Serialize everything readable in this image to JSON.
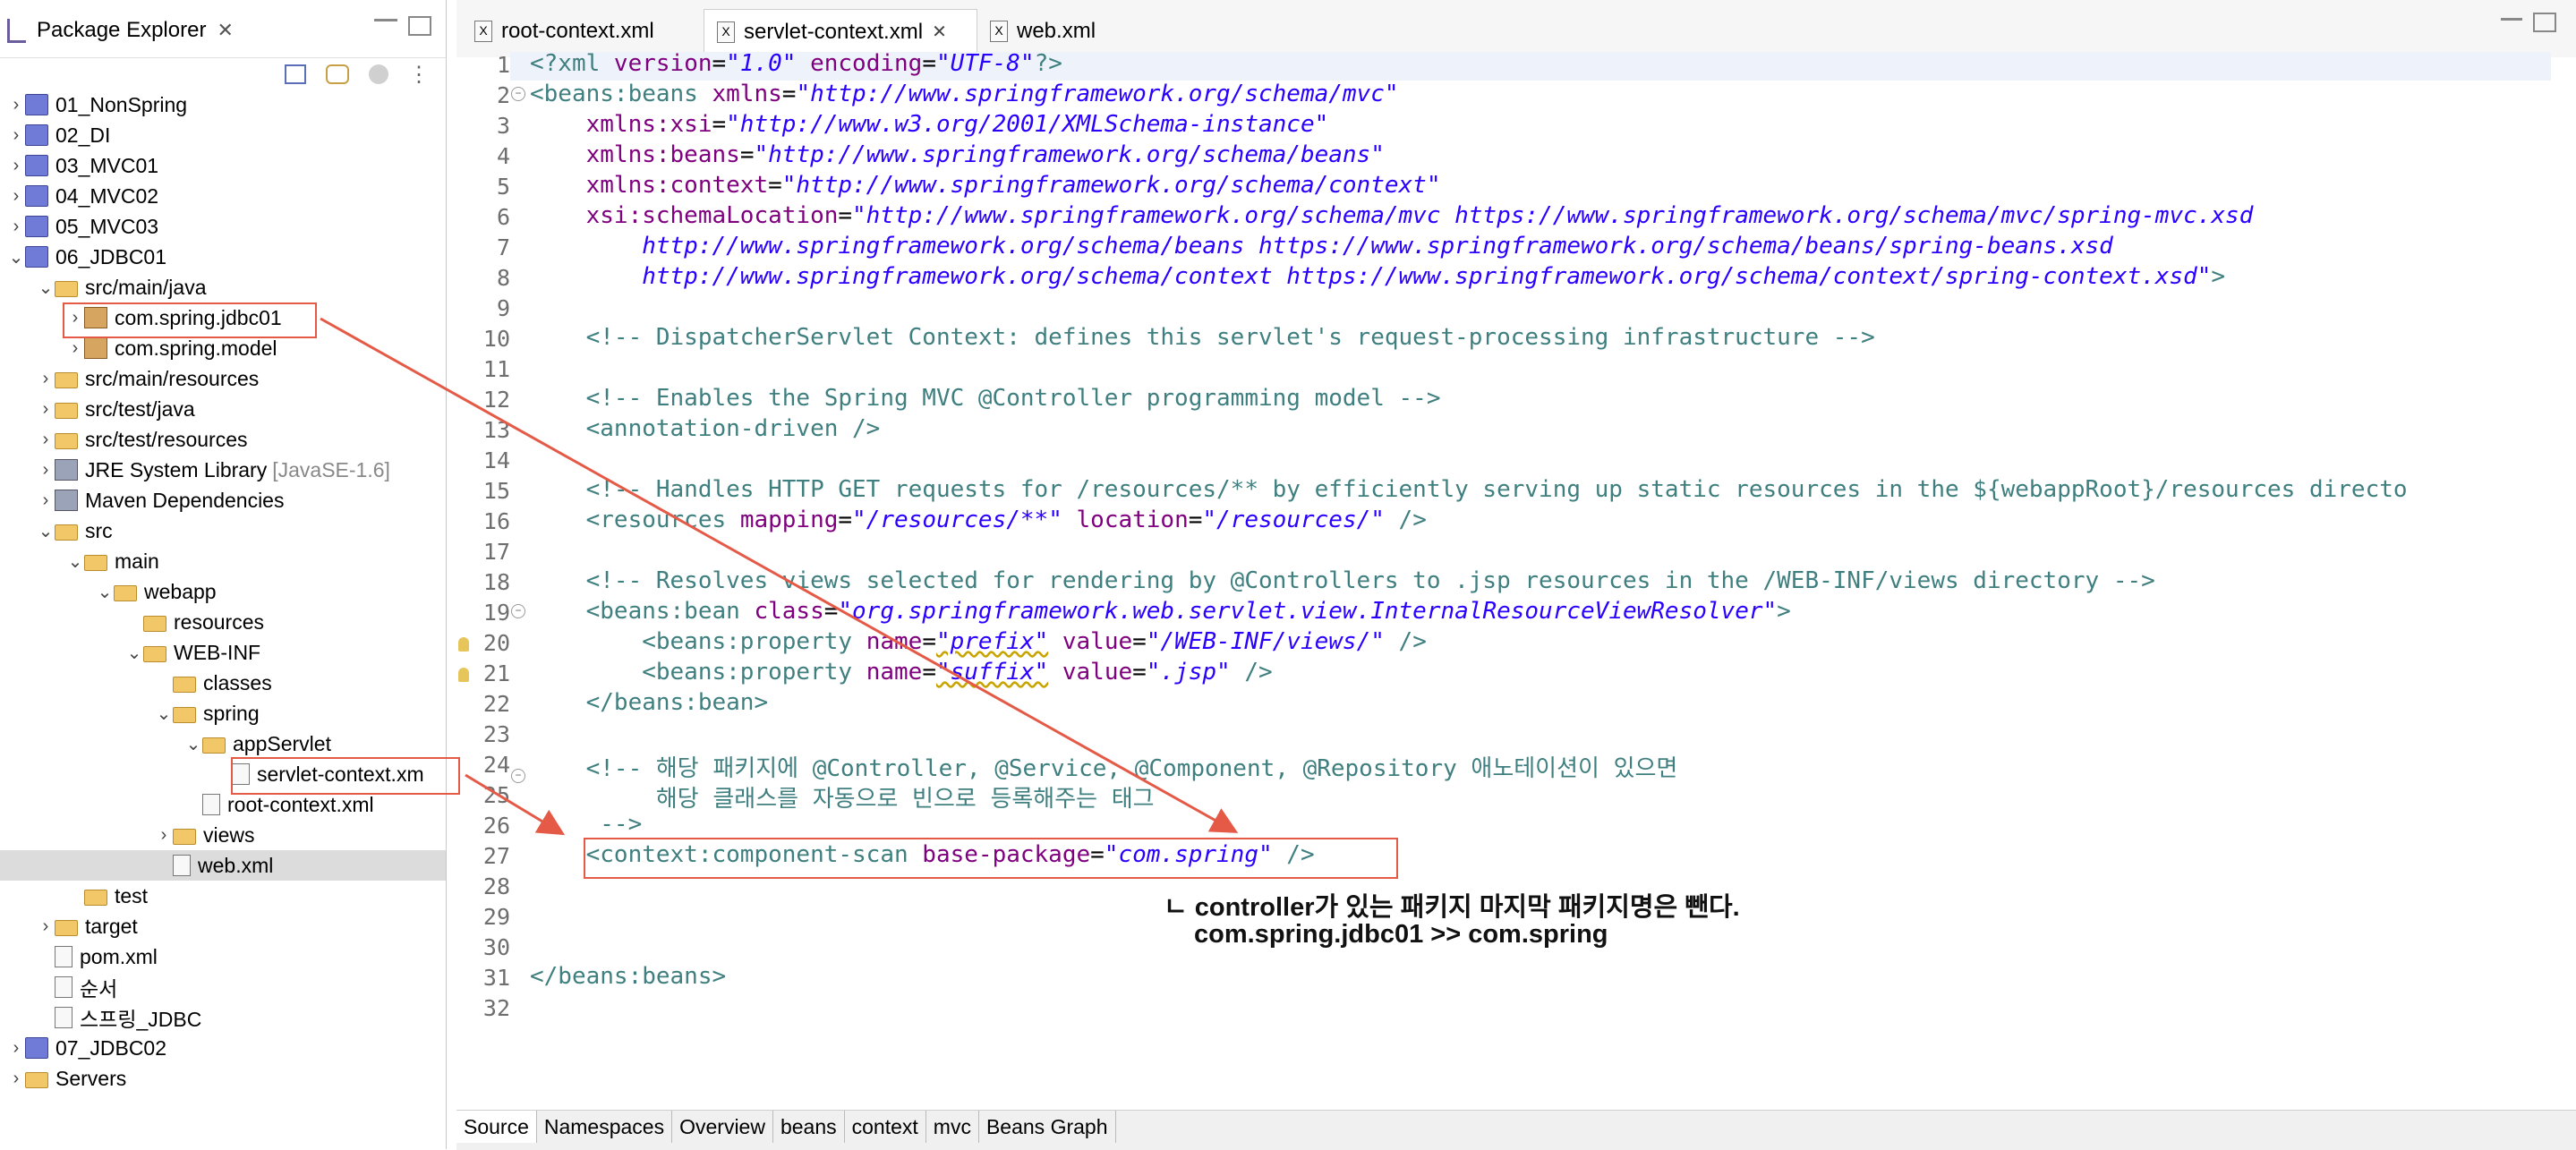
{
  "package_explorer": {
    "title": "Package Explorer",
    "tree": [
      {
        "label": "01_NonSpring",
        "level": 0,
        "arrow": "›",
        "icon": "project"
      },
      {
        "label": "02_DI",
        "level": 0,
        "arrow": "›",
        "icon": "project"
      },
      {
        "label": "03_MVC01",
        "level": 0,
        "arrow": "›",
        "icon": "project"
      },
      {
        "label": "04_MVC02",
        "level": 0,
        "arrow": "›",
        "icon": "project"
      },
      {
        "label": "05_MVC03",
        "level": 0,
        "arrow": "›",
        "icon": "project"
      },
      {
        "label": "06_JDBC01",
        "level": 0,
        "arrow": "⌄",
        "icon": "project"
      },
      {
        "label": "src/main/java",
        "level": 1,
        "arrow": "⌄",
        "icon": "source-folder"
      },
      {
        "label": "com.spring.jdbc01",
        "level": 2,
        "arrow": "›",
        "icon": "package"
      },
      {
        "label": "com.spring.model",
        "level": 2,
        "arrow": "›",
        "icon": "package"
      },
      {
        "label": "src/main/resources",
        "level": 1,
        "arrow": "›",
        "icon": "source-folder"
      },
      {
        "label": "src/test/java",
        "level": 1,
        "arrow": "›",
        "icon": "source-folder"
      },
      {
        "label": "src/test/resources",
        "level": 1,
        "arrow": "›",
        "icon": "source-folder"
      },
      {
        "label": "JRE System Library",
        "decor": "[JavaSE-1.6]",
        "level": 1,
        "arrow": "›",
        "icon": "library"
      },
      {
        "label": "Maven Dependencies",
        "level": 1,
        "arrow": "›",
        "icon": "library"
      },
      {
        "label": "src",
        "level": 1,
        "arrow": "⌄",
        "icon": "folder"
      },
      {
        "label": "main",
        "level": 2,
        "arrow": "⌄",
        "icon": "folder"
      },
      {
        "label": "webapp",
        "level": 3,
        "arrow": "⌄",
        "icon": "folder"
      },
      {
        "label": "resources",
        "level": 4,
        "arrow": "",
        "icon": "folder"
      },
      {
        "label": "WEB-INF",
        "level": 4,
        "arrow": "⌄",
        "icon": "folder"
      },
      {
        "label": "classes",
        "level": 5,
        "arrow": "",
        "icon": "folder"
      },
      {
        "label": "spring",
        "level": 5,
        "arrow": "⌄",
        "icon": "folder"
      },
      {
        "label": "appServlet",
        "level": 6,
        "arrow": "⌄",
        "icon": "folder"
      },
      {
        "label": "servlet-context.xm",
        "level": 7,
        "arrow": "",
        "icon": "xml-file"
      },
      {
        "label": "root-context.xml",
        "level": 6,
        "arrow": "",
        "icon": "xml-file"
      },
      {
        "label": "views",
        "level": 5,
        "arrow": "›",
        "icon": "folder"
      },
      {
        "label": "web.xml",
        "level": 5,
        "arrow": "",
        "icon": "xml-file",
        "selected": true
      },
      {
        "label": "test",
        "level": 2,
        "arrow": "",
        "icon": "folder"
      },
      {
        "label": "target",
        "level": 1,
        "arrow": "›",
        "icon": "folder"
      },
      {
        "label": "pom.xml",
        "level": 1,
        "arrow": "",
        "icon": "xml-file"
      },
      {
        "label": "순서",
        "level": 1,
        "arrow": "",
        "icon": "file"
      },
      {
        "label": "스프링_JDBC",
        "level": 1,
        "arrow": "",
        "icon": "file"
      },
      {
        "label": "07_JDBC02",
        "level": 0,
        "arrow": "›",
        "icon": "project"
      },
      {
        "label": "Servers",
        "level": 0,
        "arrow": "›",
        "icon": "folder"
      }
    ]
  },
  "editor_tabs": [
    {
      "label": "root-context.xml",
      "active": false
    },
    {
      "label": "servlet-context.xml",
      "active": true,
      "close": "✕"
    },
    {
      "label": "web.xml",
      "active": false
    }
  ],
  "code_lines": [
    "1",
    "2",
    "3",
    "4",
    "5",
    "6",
    "7",
    "8",
    "9",
    "10",
    "11",
    "12",
    "13",
    "14",
    "15",
    "16",
    "17",
    "18",
    "19",
    "20",
    "21",
    "22",
    "23",
    "24",
    "25",
    "26",
    "27",
    "28",
    "29",
    "30",
    "31",
    "32"
  ],
  "code": {
    "l1_a": "<?xml ",
    "l1_b": "version",
    "l1_c": "=",
    "l1_d": "\"1.0\"",
    "l1_e": " encoding",
    "l1_f": "=",
    "l1_g": "\"UTF-8\"",
    "l1_h": "?>",
    "l2_a": "<beans:beans ",
    "l2_b": "xmlns",
    "l2_c": "=",
    "l2_d": "\"http://www.springframework.org/schema/mvc\"",
    "l3_b": "    xmlns:xsi",
    "l3_d": "\"http://www.w3.org/2001/XMLSchema-instance\"",
    "l4_b": "    xmlns:beans",
    "l4_d": "\"http://www.springframework.org/schema/beans\"",
    "l5_b": "    xmlns:context",
    "l5_d": "\"http://www.springframework.org/schema/context\"",
    "l6_b": "    xsi:schemaLocation",
    "l6_d": "\"http://www.springframework.org/schema/mvc https://www.springframework.org/schema/mvc/spring-mvc.xsd",
    "l7_d": "        http://www.springframework.org/schema/beans https://www.springframework.org/schema/beans/spring-beans.xsd",
    "l8_d": "        http://www.springframework.org/schema/context https://www.springframework.org/schema/context/spring-context.xsd\"",
    "l8_e": ">",
    "l10": "    <!-- DispatcherServlet Context: defines this servlet's request-processing infrastructure -->",
    "l12": "    <!-- Enables the Spring MVC @Controller programming model -->",
    "l13": "    <annotation-driven />",
    "l15": "    <!-- Handles HTTP GET requests for /resources/** by efficiently serving up static resources in the ${webappRoot}/resources directo",
    "l16_a": "    <resources ",
    "l16_b": "mapping",
    "l16_c": "=",
    "l16_d": "\"/resources/**\"",
    "l16_e": " location",
    "l16_f": "=",
    "l16_g": "\"/resources/\"",
    "l16_h": " />",
    "l18": "    <!-- Resolves views selected for rendering by @Controllers to .jsp resources in the /WEB-INF/views directory -->",
    "l19_a": "    <beans:bean ",
    "l19_b": "class",
    "l19_c": "=",
    "l19_d": "\"org.springframework.web.servlet.view.InternalResourceViewResolver\"",
    "l19_e": ">",
    "l20_a": "        <beans:property ",
    "l20_b": "name",
    "l20_c": "=",
    "l20_d": "\"prefix\"",
    "l20_e": " value",
    "l20_f": "=",
    "l20_g": "\"/WEB-INF/views/\"",
    "l20_h": " />",
    "l21_a": "        <beans:property ",
    "l21_b": "name",
    "l21_c": "=",
    "l21_d": "\"suffix\"",
    "l21_e": " value",
    "l21_f": "=",
    "l21_g": "\".jsp\"",
    "l21_h": " />",
    "l22": "    </beans:bean>",
    "l24": "    <!-- 해당 패키지에 @Controller, @Service, @Component, @Repository 애노테이션이 있으면",
    "l25": "         해당 클래스를 자동으로 빈으로 등록해주는 태그",
    "l26": "     -->",
    "l27_a": "    <context:component-scan ",
    "l27_b": "base-package",
    "l27_c": "=",
    "l27_d": "\"com.spring\"",
    "l27_e": " />",
    "l31": "</beans:beans>"
  },
  "annotation": {
    "line1": "ㄴ controller가 있는 패키지 마지막 패키지명은 뺀다.",
    "line2": "com.spring.jdbc01 >> com.spring"
  },
  "bottom_tabs": [
    "Source",
    "Namespaces",
    "Overview",
    "beans",
    "context",
    "mvc",
    "Beans Graph"
  ],
  "colors": {
    "annotation_red": "#e55a47",
    "xml_tag": "#3f7f7f",
    "xml_attr": "#7f007f",
    "xml_value": "#2a00ff",
    "xml_comment": "#3f5fbf"
  }
}
